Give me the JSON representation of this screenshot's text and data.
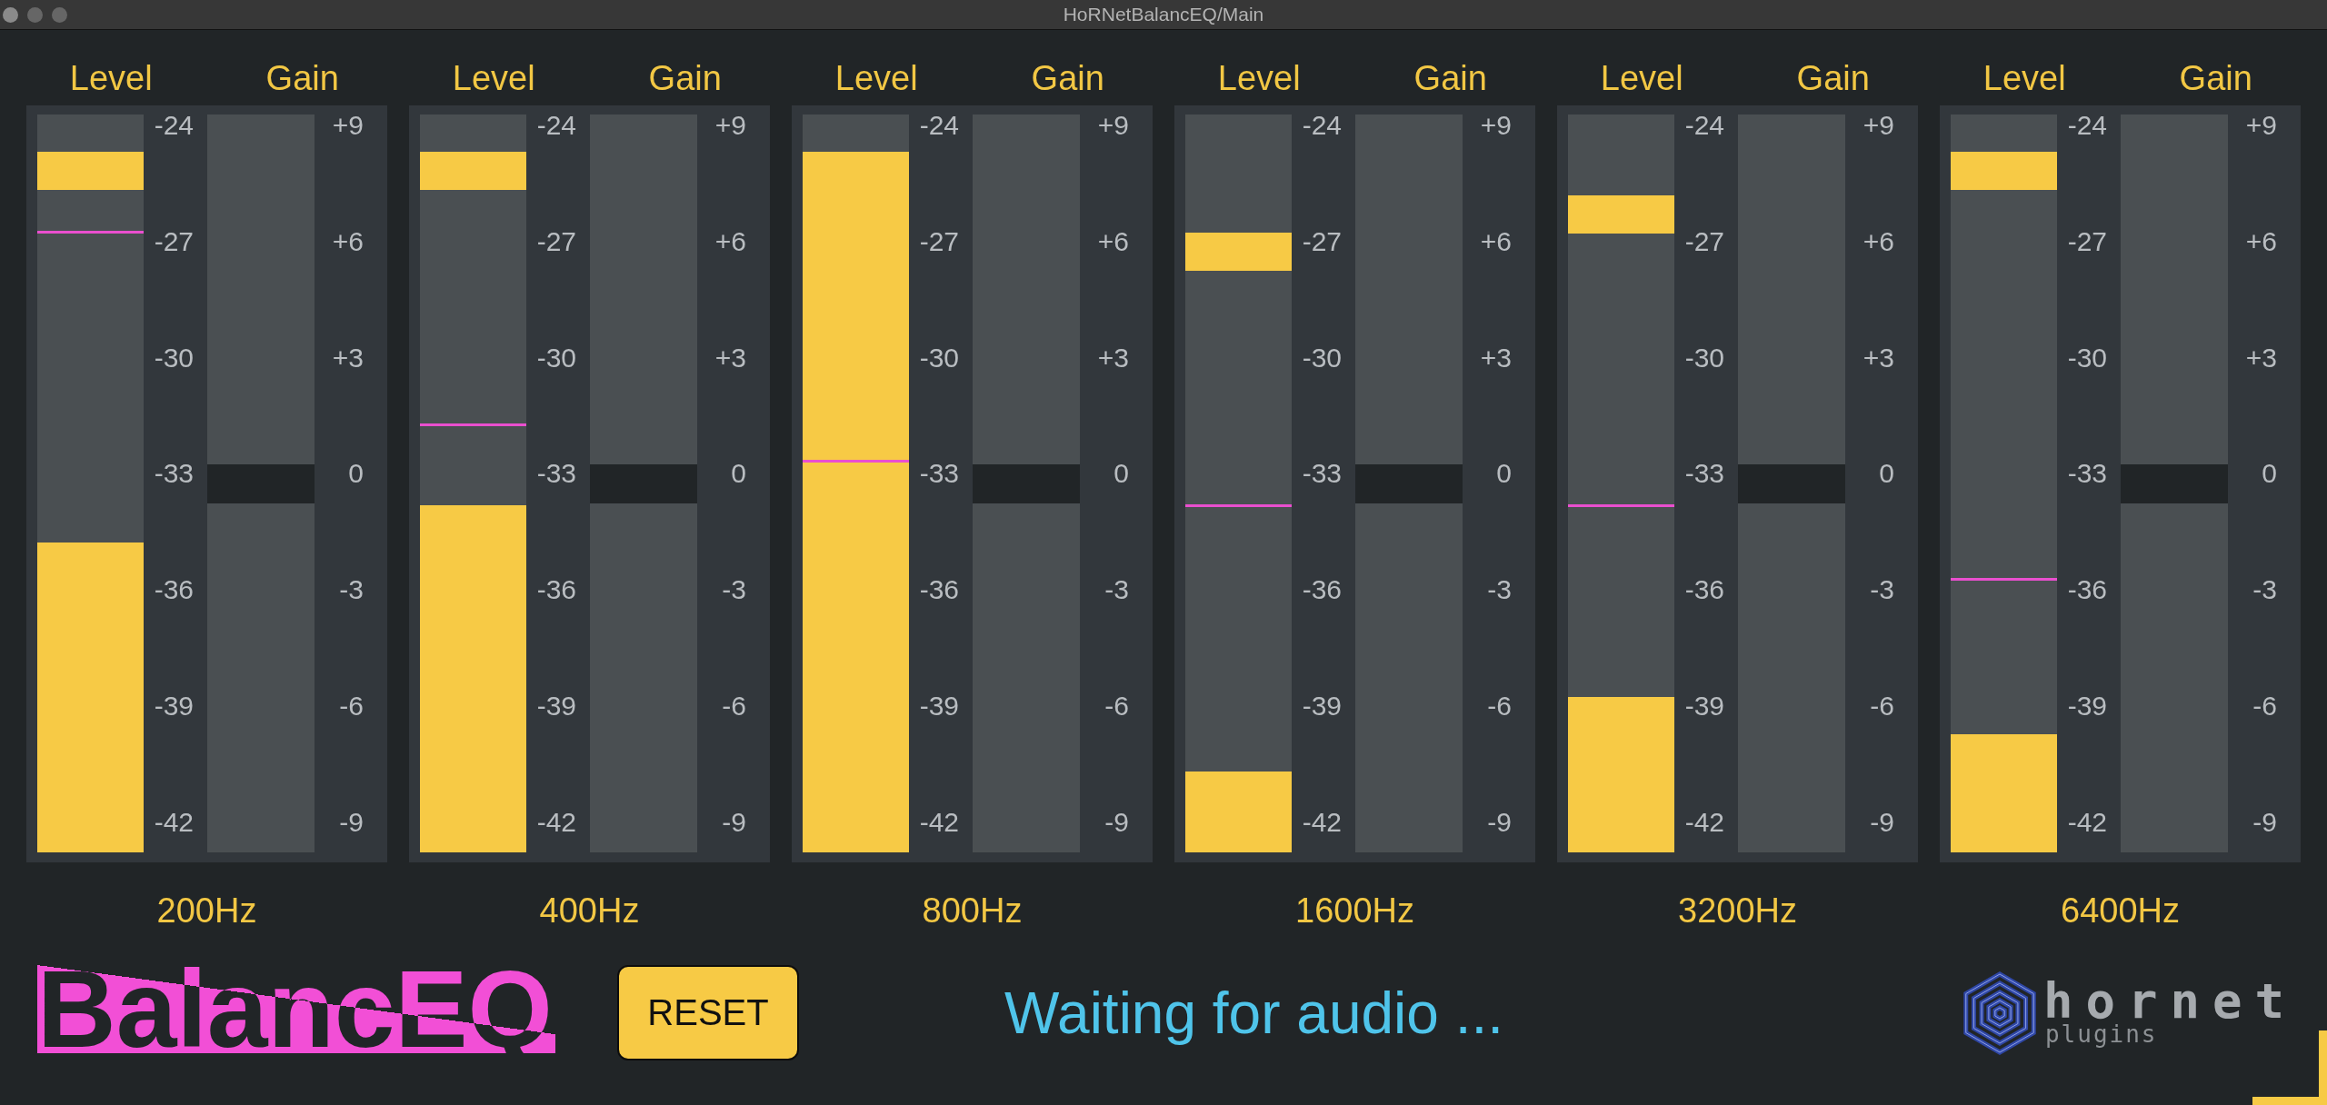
{
  "window": {
    "title": "HoRNetBalancEQ/Main"
  },
  "bands": [
    {
      "level_label": "Level",
      "gain_label": "Gain",
      "meter": {
        "level": 0.42
      },
      "peak_hold": {
        "level": 0.95
      },
      "marker_line": {
        "level": 0.84
      },
      "level_scale": [
        "-24",
        "-27",
        "-30",
        "-33",
        "-36",
        "-39",
        "-42"
      ],
      "gain_slider": {
        "level": 0.5
      },
      "gain_scale": [
        "+9",
        "+6",
        "+3",
        "0",
        "-3",
        "-6",
        "-9"
      ],
      "frequency": "200Hz"
    },
    {
      "level_label": "Level",
      "gain_label": "Gain",
      "meter": {
        "level": 0.47
      },
      "peak_hold": {
        "level": 0.95
      },
      "marker_line": {
        "level": 0.58
      },
      "level_scale": [
        "-24",
        "-27",
        "-30",
        "-33",
        "-36",
        "-39",
        "-42"
      ],
      "gain_slider": {
        "level": 0.5
      },
      "gain_scale": [
        "+9",
        "+6",
        "+3",
        "0",
        "-3",
        "-6",
        "-9"
      ],
      "frequency": "400Hz"
    },
    {
      "level_label": "Level",
      "gain_label": "Gain",
      "meter": {
        "level": 0.95
      },
      "marker_line": {
        "level": 0.53
      },
      "level_scale": [
        "-24",
        "-27",
        "-30",
        "-33",
        "-36",
        "-39",
        "-42"
      ],
      "gain_slider": {
        "level": 0.5
      },
      "gain_scale": [
        "+9",
        "+6",
        "+3",
        "0",
        "-3",
        "-6",
        "-9"
      ],
      "frequency": "800Hz"
    },
    {
      "level_label": "Level",
      "gain_label": "Gain",
      "meter": {
        "level": 0.11
      },
      "peak_hold": {
        "level": 0.84
      },
      "marker_line": {
        "level": 0.47
      },
      "level_scale": [
        "-24",
        "-27",
        "-30",
        "-33",
        "-36",
        "-39",
        "-42"
      ],
      "gain_slider": {
        "level": 0.5
      },
      "gain_scale": [
        "+9",
        "+6",
        "+3",
        "0",
        "-3",
        "-6",
        "-9"
      ],
      "frequency": "1600Hz"
    },
    {
      "level_label": "Level",
      "gain_label": "Gain",
      "meter": {
        "level": 0.21
      },
      "peak_hold": {
        "level": 0.89
      },
      "marker_line": {
        "level": 0.47
      },
      "level_scale": [
        "-24",
        "-27",
        "-30",
        "-33",
        "-36",
        "-39",
        "-42"
      ],
      "gain_slider": {
        "level": 0.5
      },
      "gain_scale": [
        "+9",
        "+6",
        "+3",
        "0",
        "-3",
        "-6",
        "-9"
      ],
      "frequency": "3200Hz"
    },
    {
      "level_label": "Level",
      "gain_label": "Gain",
      "meter": {
        "level": 0.16
      },
      "peak_hold": {
        "level": 0.95
      },
      "marker_line": {
        "level": 0.37
      },
      "level_scale": [
        "-24",
        "-27",
        "-30",
        "-33",
        "-36",
        "-39",
        "-42"
      ],
      "gain_slider": {
        "level": 0.5
      },
      "gain_scale": [
        "+9",
        "+6",
        "+3",
        "0",
        "-3",
        "-6",
        "-9"
      ],
      "frequency": "6400Hz"
    }
  ],
  "logo": "BalancEQ",
  "reset_button": "RESET",
  "status": "Waiting for audio ...",
  "brand": {
    "name": "hornet",
    "subtitle": "plugins"
  }
}
